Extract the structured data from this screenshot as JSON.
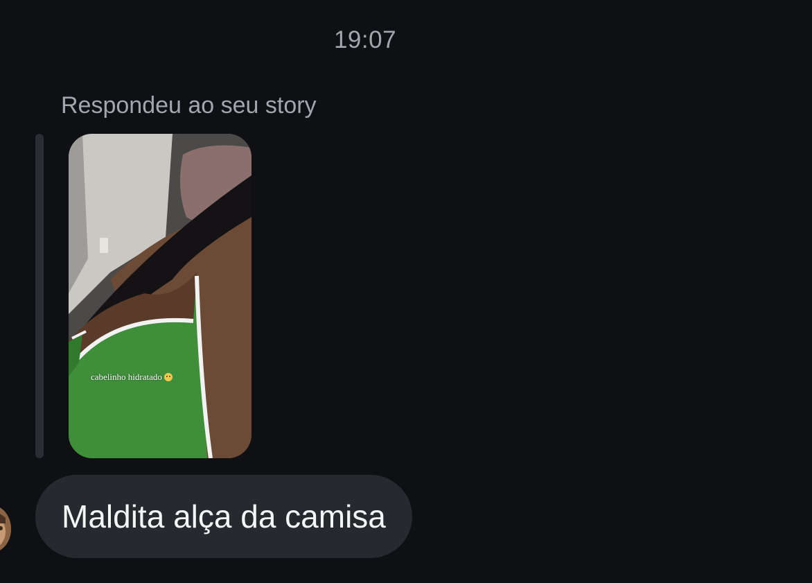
{
  "conversation": {
    "timestamp": "19:07",
    "reply_context": "Respondeu ao seu story",
    "story": {
      "caption": "cabelinho hidratado",
      "caption_emoji": "pleading-face-emoji"
    },
    "message": {
      "text": "Maldita alça da camisa"
    }
  },
  "colors": {
    "background": "#0e1014",
    "bubble": "#26292e",
    "secondary_text": "#a3a7ad",
    "message_text": "#f4f5f6"
  }
}
